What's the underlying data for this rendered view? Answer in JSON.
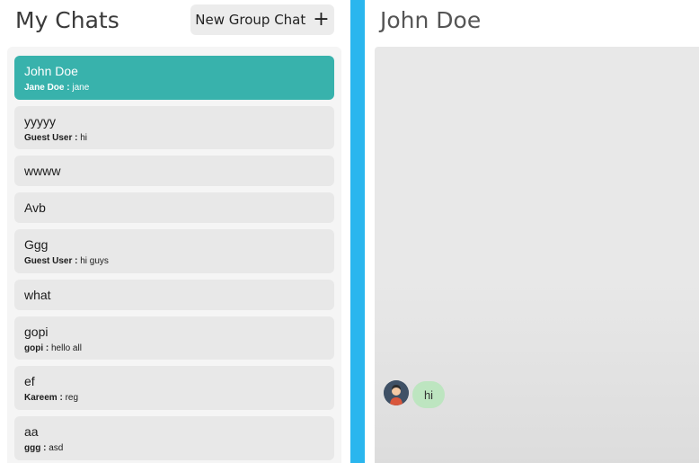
{
  "sidebar": {
    "title": "My Chats",
    "new_group_label": "New Group Chat",
    "new_group_icon": "plus-icon",
    "chats": [
      {
        "name": "John Doe",
        "sender": "Jane Doe :",
        "message": "jane",
        "active": true
      },
      {
        "name": "yyyyy",
        "sender": "Guest User :",
        "message": "hi"
      },
      {
        "name": "wwww",
        "sender": "",
        "message": ""
      },
      {
        "name": "Avb",
        "sender": "",
        "message": ""
      },
      {
        "name": "Ggg",
        "sender": "Guest User :",
        "message": "hi guys"
      },
      {
        "name": "what",
        "sender": "",
        "message": ""
      },
      {
        "name": "gopi",
        "sender": "gopi :",
        "message": "hello all"
      },
      {
        "name": "ef",
        "sender": "Kareem :",
        "message": "reg"
      },
      {
        "name": "aa",
        "sender": "ggg :",
        "message": "asd"
      }
    ]
  },
  "chat": {
    "title": "John Doe",
    "messages": [
      {
        "text": "hi"
      }
    ]
  },
  "colors": {
    "accent": "#38b2ac",
    "divider": "#2ab6ee",
    "bubble": "#bde5c0"
  }
}
